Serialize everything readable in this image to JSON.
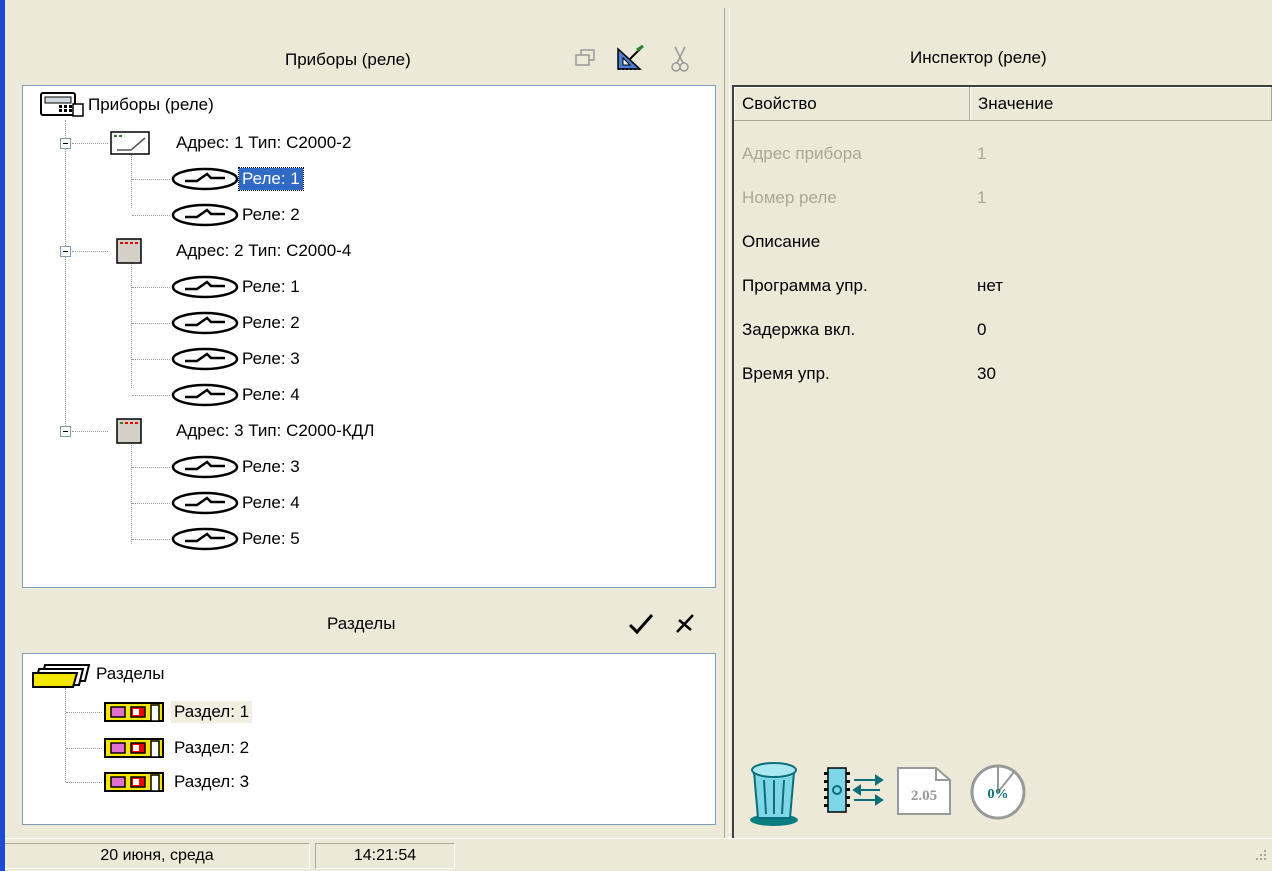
{
  "devices_panel": {
    "title": "Приборы  (реле)",
    "root_label": "Приборы (реле)",
    "devices": [
      {
        "label": "Адрес: 1 Тип: С2000-2",
        "relays": [
          "Реле: 1",
          "Реле: 2"
        ]
      },
      {
        "label": "Адрес: 2 Тип: С2000-4",
        "relays": [
          "Реле: 1",
          "Реле: 2",
          "Реле: 3",
          "Реле: 4"
        ]
      },
      {
        "label": "Адрес: 3 Тип: С2000-КДЛ",
        "relays": [
          "Реле: 3",
          "Реле: 4",
          "Реле: 5"
        ]
      }
    ],
    "selected": "Реле: 1",
    "toolbar_icons": [
      "windows-icon",
      "set-square-icon",
      "scissors-icon"
    ]
  },
  "sections_panel": {
    "title": "Разделы",
    "root_label": "Разделы",
    "items": [
      "Раздел: 1",
      "Раздел: 2",
      "Раздел: 3"
    ],
    "toolbar_icons": [
      "checkmark-icon",
      "cross-icon"
    ]
  },
  "inspector": {
    "title": "Инспектор (реле)",
    "col_property": "Свойство",
    "col_value": "Значение",
    "rows": [
      {
        "prop": "Адрес прибора",
        "value": "1",
        "disabled": true
      },
      {
        "prop": "Номер реле",
        "value": "1",
        "disabled": true
      },
      {
        "prop": "Описание",
        "value": "",
        "disabled": false
      },
      {
        "prop": "Программа упр.",
        "value": "нет",
        "disabled": false
      },
      {
        "prop": "Задержка вкл.",
        "value": "0",
        "disabled": false
      },
      {
        "prop": "Время упр.",
        "value": "30",
        "disabled": false
      }
    ],
    "bottom_icons": [
      "trash-icon",
      "chip-transfer-icon",
      "version-doc-icon",
      "progress-gauge-icon"
    ],
    "version_label": "2.05",
    "gauge_label": "0%"
  },
  "status_bar": {
    "date": "20 июня, среда",
    "time": "14:21:54"
  },
  "colors": {
    "selection": "#316ac5",
    "window_bg": "#ece9d8",
    "border": "#7f9db9"
  }
}
